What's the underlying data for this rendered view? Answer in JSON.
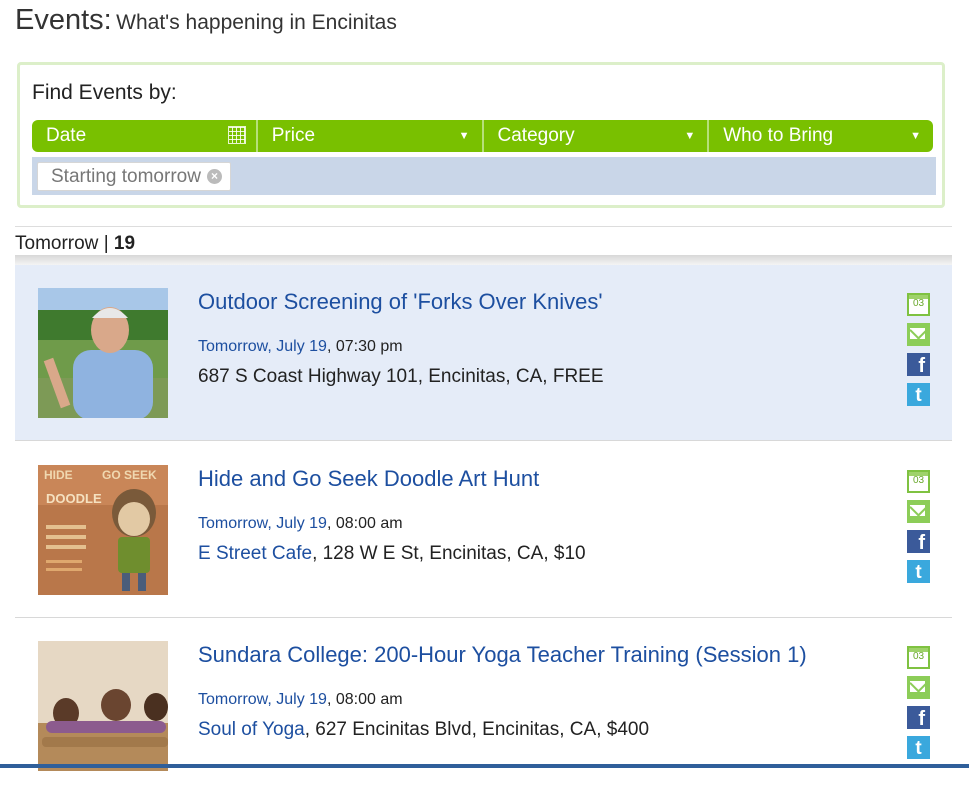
{
  "page": {
    "title": "Events:",
    "subtitle": "What's happening in Encinitas"
  },
  "finder": {
    "label": "Find Events by:",
    "filters": [
      {
        "label": "Date",
        "icon": "calendar-icon"
      },
      {
        "label": "Price",
        "icon": "caret-down-icon"
      },
      {
        "label": "Category",
        "icon": "caret-down-icon"
      },
      {
        "label": "Who to Bring",
        "icon": "caret-down-icon"
      }
    ],
    "active_chip": "Starting tomorrow"
  },
  "day": {
    "label": "Tomorrow",
    "separator": "|",
    "number": "19"
  },
  "events": [
    {
      "title": "Outdoor Screening of 'Forks Over Knives'",
      "date": "Tomorrow, July 19",
      "time": ", 07:30 pm",
      "venue": "",
      "address": "687 S Coast Highway 101, Encinitas, CA, FREE",
      "highlighted": true
    },
    {
      "title": "Hide and Go Seek Doodle Art Hunt",
      "date": "Tomorrow, July 19",
      "time": ", 08:00 am",
      "venue": "E Street Cafe",
      "address": ", 128 W E St, Encinitas, CA, $10",
      "highlighted": false
    },
    {
      "title": "Sundara College: 200-Hour Yoga Teacher Training (Session 1)",
      "date": "Tomorrow, July 19",
      "time": ", 08:00 am",
      "venue": "Soul of Yoga",
      "address": ", 627 Encinitas Blvd, Encinitas, CA, $400",
      "highlighted": false
    }
  ],
  "actions": {
    "calendar_text": "03",
    "facebook_text": "f",
    "twitter_text": "t"
  },
  "colors": {
    "filter_bar": "#79c000",
    "link": "#1d4fa0",
    "highlight_row": "#e5ecf8",
    "chip_row": "#c9d6e8"
  }
}
